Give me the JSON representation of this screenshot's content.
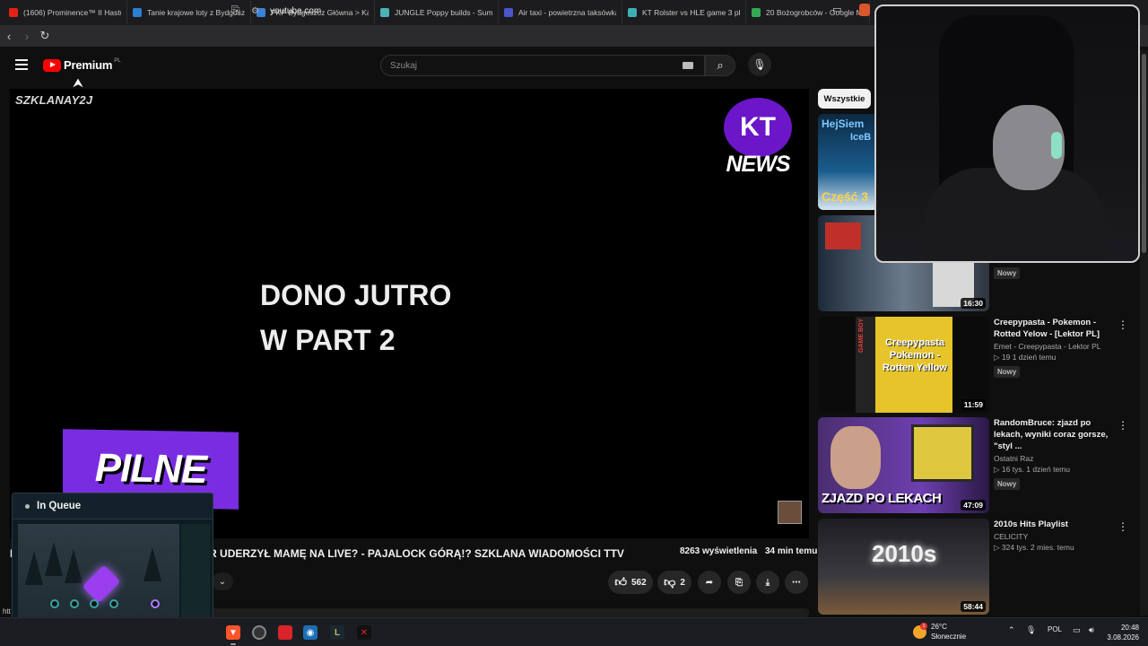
{
  "tabs": [
    {
      "title": "(1606) Prominence™ II Hastur",
      "color": "#e62117"
    },
    {
      "title": "Tanie krajowe loty z Bydgoszcz",
      "color": "#2d7fd1"
    },
    {
      "title": "PKP Bydgoszcz Główna > Katow",
      "color": "#3b82d8"
    },
    {
      "title": "JUNGLE Poppy builds - Summo",
      "color": "#4bb3b7"
    },
    {
      "title": "Air taxi - powietrzna taksówka",
      "color": "#4a56c9"
    },
    {
      "title": "KT Rolster vs HLE game 3 play",
      "color": "#3db0b5"
    },
    {
      "title": "20 Bożogrobców - Google Ma",
      "color": "#34a853"
    }
  ],
  "address": {
    "url": "youtube.com",
    "back_icon": "chevron-left-icon",
    "forward_icon": "chevron-right-icon",
    "reload_icon": "reload-icon",
    "bookmark_icon": "bookmark-icon"
  },
  "yt": {
    "logo_text": "Premium",
    "country": "PL",
    "search_placeholder": "Szukaj"
  },
  "player": {
    "watermark": "SZKLANAY2J",
    "news_logo_letters": "KT",
    "news_logo_word": "NEWS",
    "center_line1": "DONO JUTRO",
    "center_line2": "W PART 2",
    "pilne": "PILNE"
  },
  "video": {
    "title": "R UDERZYŁ MAMĘ NA LIVE? - PAJALOCK GÓRĄ!? SZKLANA WIADOMOŚCI TTV",
    "title_prefix": "I",
    "views": "8263 wyświetlenia",
    "age": "34 min temu",
    "likes": "562",
    "dislikes": "2"
  },
  "sidebar": {
    "chip": "Wszystkie",
    "recs": [
      {
        "title": "",
        "channel": "",
        "stats": "",
        "badge": "",
        "duration": ""
      },
      {
        "title": "",
        "channel": "",
        "stats": "",
        "badge": "Nowy",
        "duration": "16:30"
      },
      {
        "title": "Creepypasta - Pokemon - Rotted Yelow - [Lektor PL]",
        "channel": "Emet - Creepypasta - Lektor PL",
        "stats": "19   1 dzień temu",
        "badge": "Nowy",
        "duration": "11:59"
      },
      {
        "title": "RandomBruce: zjazd po lekach, wyniki coraz gorsze, \"styl ...",
        "channel": "Ostatni Raz",
        "stats": "16 tys.   1 dzień temu",
        "badge": "Nowy",
        "duration": "47:09"
      },
      {
        "title": "2010s Hits Playlist",
        "channel": "CELICITY",
        "stats": "324 tys.   2 mies. temu",
        "badge": "",
        "duration": "58:44"
      }
    ],
    "thumb_texts": {
      "t1_top": "HejSiem",
      "t1_mid": "IceB",
      "t1_bottom": "Część 3",
      "t3_line1": "Creepypasta",
      "t3_line2": "Pokemon -",
      "t3_line3": "Rotten Yellow",
      "t3_side": "GAME BOY",
      "t4": "ZJAZD PO LEKACH",
      "t5": "2010s"
    }
  },
  "game_overlay": {
    "status": "In Queue"
  },
  "taskbar": {
    "truncated": "htt",
    "temp": "26°C",
    "weather": "Słonecznie",
    "weather_badge": "1",
    "lang": "POL",
    "time": "20:48",
    "date": "3.08.2026"
  }
}
